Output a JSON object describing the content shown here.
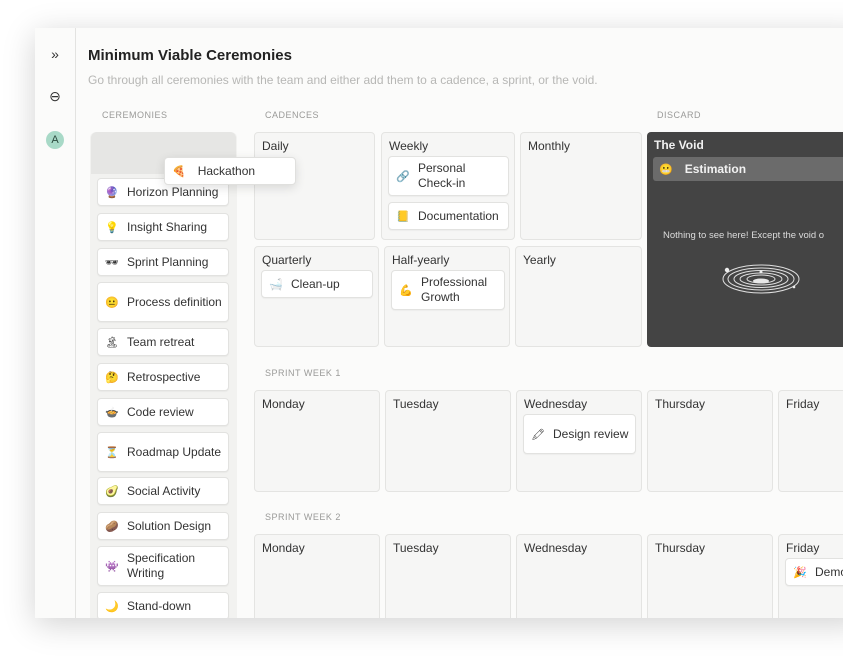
{
  "header": {
    "title": "Minimum Viable Ceremonies",
    "subtitle": "Go through all ceremonies with the team and either add them to a cadence, a sprint, or the void."
  },
  "rail": {
    "expand_icon": "»",
    "link_icon": "⊖",
    "avatar_letter": "A"
  },
  "sections": {
    "ceremonies": "CEREMONIES",
    "cadences": "CADENCES",
    "discard": "DISCARD",
    "sprint1": "SPRINT WEEK 1",
    "sprint2": "SPRINT WEEK 2"
  },
  "dragging": {
    "icon": "🍕",
    "label": "Hackathon"
  },
  "ceremonies": [
    {
      "icon": "🔮",
      "label": "Horizon Planning"
    },
    {
      "icon": "💡",
      "label": "Insight Sharing"
    },
    {
      "icon": "🕶",
      "label": "Sprint Planning"
    },
    {
      "icon": "😐",
      "label": "Process definition"
    },
    {
      "icon": "🏝",
      "label": "Team retreat"
    },
    {
      "icon": "🤔",
      "label": "Retrospective"
    },
    {
      "icon": "🍲",
      "label": "Code review"
    },
    {
      "icon": "⏳",
      "label": "Roadmap Update"
    },
    {
      "icon": "🥑",
      "label": "Social Activity"
    },
    {
      "icon": "🥔",
      "label": "Solution Design"
    },
    {
      "icon": "👾",
      "label": "Specification Writing"
    },
    {
      "icon": "🌙",
      "label": "Stand-down"
    }
  ],
  "cadences": {
    "daily": {
      "label": "Daily"
    },
    "weekly": {
      "label": "Weekly",
      "items": [
        {
          "icon": "🔗",
          "label": "Personal Check-in"
        },
        {
          "icon": "📒",
          "label": "Documentation"
        }
      ]
    },
    "monthly": {
      "label": "Monthly"
    },
    "quarterly": {
      "label": "Quarterly",
      "items": [
        {
          "icon": "🛁",
          "label": "Clean-up"
        }
      ]
    },
    "halfyearly": {
      "label": "Half-yearly",
      "items": [
        {
          "icon": "💪",
          "label": "Professional Growth"
        }
      ]
    },
    "yearly": {
      "label": "Yearly"
    }
  },
  "void": {
    "title": "The Void",
    "item": {
      "icon": "😬",
      "label": "Estimation"
    },
    "empty_message": "Nothing to see here! Except the void o"
  },
  "sprint1": {
    "days": [
      "Monday",
      "Tuesday",
      "Wednesday",
      "Thursday",
      "Friday"
    ],
    "wednesday_item": {
      "icon": "🖍",
      "label": "Design review"
    }
  },
  "sprint2": {
    "days": [
      "Monday",
      "Tuesday",
      "Wednesday",
      "Thursday",
      "Friday"
    ],
    "friday_item": {
      "icon": "🎉",
      "label": "Demo"
    }
  }
}
